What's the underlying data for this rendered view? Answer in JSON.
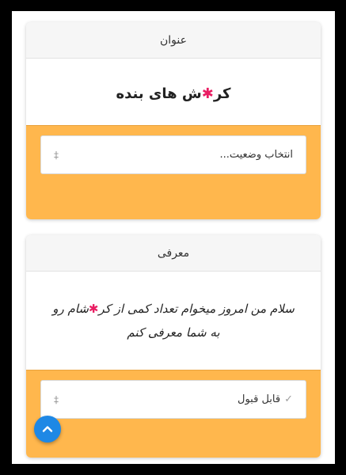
{
  "cards": [
    {
      "header": "عنوان",
      "body": "کر✱ش های بنده",
      "select": {
        "value": "انتخاب وضعیت...",
        "arrow": "‡"
      }
    },
    {
      "header": "معرفی",
      "body_lines": [
        "سلام من امروز میخوام تعداد کمی از کر✱شام رو",
        "به شما معرفی کنم"
      ],
      "select": {
        "check": "✓",
        "value": "قابل قبول",
        "arrow": "‡"
      }
    }
  ],
  "scroll_top": {
    "icon": "chevron-up-icon"
  },
  "colors": {
    "footer": "#ffb74d",
    "accent": "#1e88e5",
    "mark": "#e91e63"
  }
}
